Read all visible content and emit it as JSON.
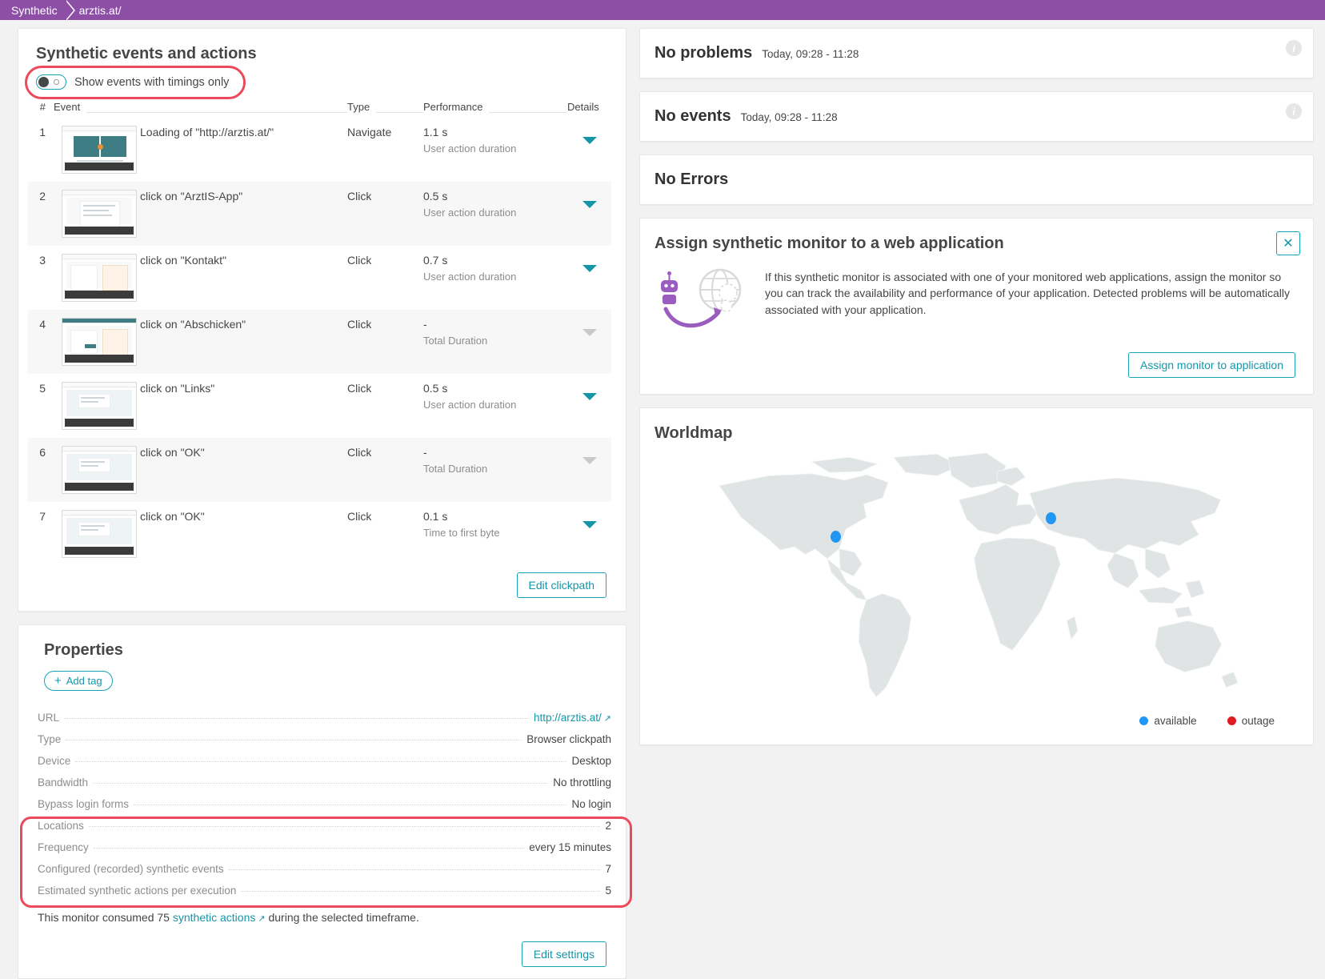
{
  "breadcrumb": {
    "root": "Synthetic",
    "current": "arztis.at/"
  },
  "events_card": {
    "title": "Synthetic events and actions",
    "toggle_label": "Show events with timings only",
    "columns": {
      "num": "#",
      "event": "Event",
      "type": "Type",
      "performance": "Performance",
      "details": "Details"
    },
    "rows": [
      {
        "num": "1",
        "event": "Loading of \"http://arztis.at/\"",
        "type": "Navigate",
        "perf": "1.1 s",
        "perf_sub": "User action duration",
        "expandable": true
      },
      {
        "num": "2",
        "event": "click on \"ArztIS-App\"",
        "type": "Click",
        "perf": "0.5 s",
        "perf_sub": "User action duration",
        "expandable": true
      },
      {
        "num": "3",
        "event": "click on \"Kontakt\"",
        "type": "Click",
        "perf": "0.7 s",
        "perf_sub": "User action duration",
        "expandable": true
      },
      {
        "num": "4",
        "event": "click on \"Abschicken\"",
        "type": "Click",
        "perf": "-",
        "perf_sub": "Total Duration",
        "expandable": false
      },
      {
        "num": "5",
        "event": "click on \"Links\"",
        "type": "Click",
        "perf": "0.5 s",
        "perf_sub": "User action duration",
        "expandable": true
      },
      {
        "num": "6",
        "event": "click on \"OK\"",
        "type": "Click",
        "perf": "-",
        "perf_sub": "Total Duration",
        "expandable": false
      },
      {
        "num": "7",
        "event": "click on \"OK\"",
        "type": "Click",
        "perf": "0.1 s",
        "perf_sub": "Time to first byte",
        "expandable": true
      }
    ],
    "edit_clickpath_label": "Edit clickpath"
  },
  "properties_card": {
    "title": "Properties",
    "add_tag_label": "Add tag",
    "rows": [
      {
        "key": "URL",
        "value": "http://arztis.at/",
        "link": true
      },
      {
        "key": "Type",
        "value": "Browser clickpath",
        "link": false
      },
      {
        "key": "Device",
        "value": "Desktop",
        "link": false
      },
      {
        "key": "Bandwidth",
        "value": "No throttling",
        "link": false
      },
      {
        "key": "Bypass login forms",
        "value": "No login",
        "link": false
      },
      {
        "key": "Locations",
        "value": "2",
        "link": false
      },
      {
        "key": "Frequency",
        "value": "every 15 minutes",
        "link": false
      },
      {
        "key": "Configured (recorded) synthetic events",
        "value": "7",
        "link": false
      },
      {
        "key": "Estimated synthetic actions per execution",
        "value": "5",
        "link": false
      }
    ],
    "consumed_prefix": "This monitor consumed 75 ",
    "consumed_link": "synthetic actions",
    "consumed_suffix": " during the selected timeframe.",
    "edit_settings_label": "Edit settings"
  },
  "problems_card": {
    "title": "No problems",
    "timeframe": "Today, 09:28 - 11:28"
  },
  "events_status_card": {
    "title": "No events",
    "timeframe": "Today, 09:28 - 11:28"
  },
  "errors_card": {
    "title": "No Errors"
  },
  "assign_card": {
    "title": "Assign synthetic monitor to a web application",
    "body": "If this synthetic monitor is associated with one of your monitored web applications, assign the monitor so you can track the availability and performance of your application. Detected problems will be automatically associated with your application.",
    "button_label": "Assign monitor to application"
  },
  "worldmap_card": {
    "title": "Worldmap",
    "legend": [
      {
        "label": "available",
        "color": "#2196f3"
      },
      {
        "label": "outage",
        "color": "#e01b22"
      }
    ],
    "markers": [
      {
        "label": "available",
        "x": 27.5,
        "y": 31.5
      },
      {
        "label": "available",
        "x": 61.0,
        "y": 24.5
      }
    ]
  },
  "colors": {
    "brand_purple": "#8c4fa5",
    "accent_teal": "#1496a8",
    "highlight_red": "#ec4a5a"
  }
}
